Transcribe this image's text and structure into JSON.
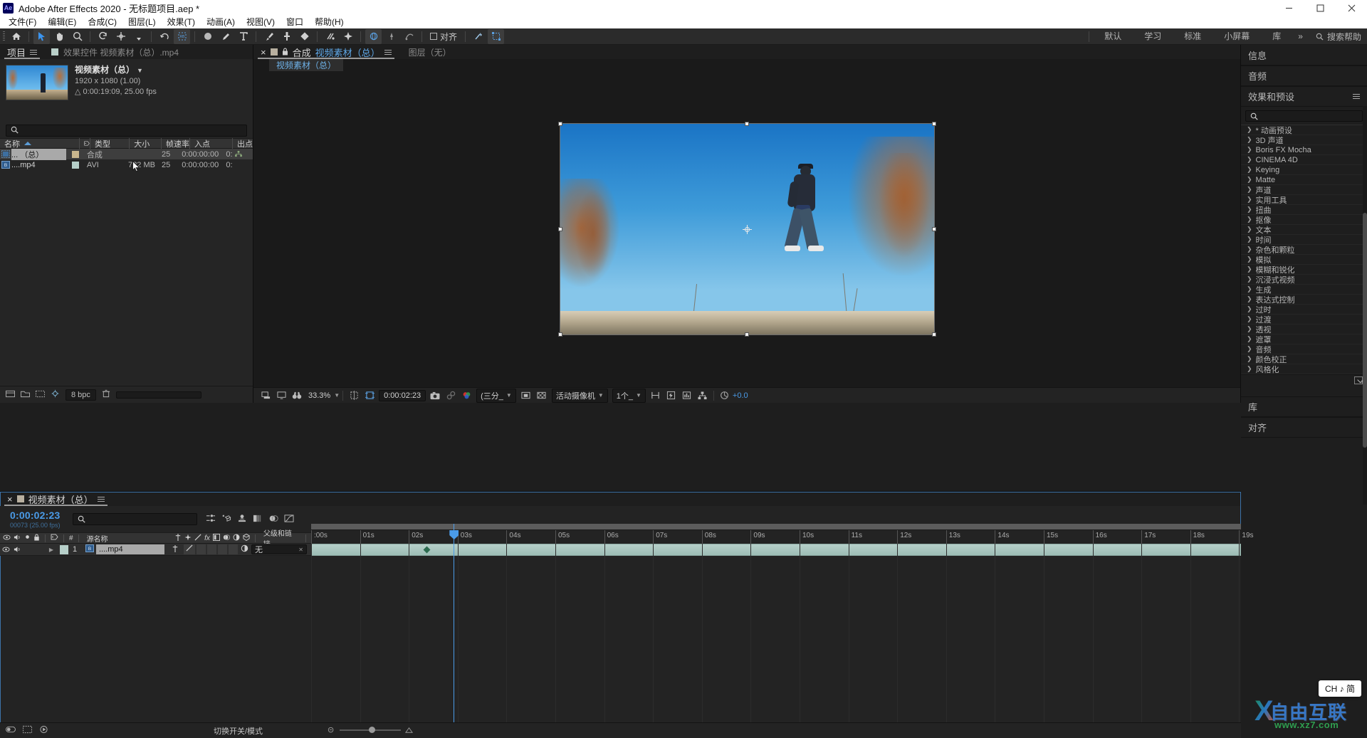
{
  "window": {
    "title": "Adobe After Effects 2020 - 无标题项目.aep *",
    "logo": "Ae",
    "buttons": [
      "minimize-button",
      "maximize-button",
      "close-button"
    ]
  },
  "menubar": {
    "items": [
      "文件(F)",
      "编辑(E)",
      "合成(C)",
      "图层(L)",
      "效果(T)",
      "动画(A)",
      "视图(V)",
      "窗口",
      "帮助(H)"
    ]
  },
  "toolbar": {
    "align_label": "对齐",
    "workspaces": [
      "默认",
      "学习",
      "标准",
      "小屏幕",
      "库"
    ],
    "overflow": "»",
    "search_placeholder": "搜索帮助"
  },
  "project": {
    "tab_project": "项目",
    "tab_effect_controls": "效果控件 视频素材（总）.mp4",
    "item_name": "视频素材（总）",
    "item_resolution": "1920 x 1080 (1.00)",
    "item_duration": "△ 0:00:19:09, 25.00 fps",
    "search_placeholder": "",
    "columns": [
      "名称",
      "类型",
      "大小",
      "帧速率",
      "入点",
      "出点"
    ],
    "rows": [
      {
        "name": "... （总）",
        "type": "合成",
        "size": "",
        "fps": "25",
        "in": "0:00:00:00",
        "out": "0:"
      },
      {
        "name": "....mp4",
        "type": "AVI",
        "size": "7?2 MB",
        "fps": "25",
        "in": "0:00:00:00",
        "out": "0:"
      }
    ],
    "bit_depth": "8 bpc"
  },
  "composition": {
    "tab_label": "合成",
    "tab_name": "视频素材（总）",
    "tab_layer": "图层（无）",
    "breadcrumb": "视频素材（总）",
    "viewer_bar": {
      "zoom": "33.3%",
      "time": "0:00:02:23",
      "resolution": "(三分_",
      "camera": "活动摄像机",
      "views": "1个_",
      "exposure": "+0.0"
    }
  },
  "right_panel": {
    "info": "信息",
    "audio": "音频",
    "effects_title": "效果和预设",
    "search_placeholder": "",
    "library": "库",
    "align": "对齐",
    "effects": [
      "* 动画预设",
      "3D 声道",
      "Boris FX Mocha",
      "CINEMA 4D",
      "Keying",
      "Matte",
      "声道",
      "实用工具",
      "扭曲",
      "抠像",
      "文本",
      "时间",
      "杂色和颗粒",
      "模拟",
      "模糊和锐化",
      "沉浸式视频",
      "生成",
      "表达式控制",
      "过时",
      "过渡",
      "透视",
      "遮罩",
      "音频",
      "颜色校正",
      "风格化"
    ]
  },
  "timeline": {
    "tab_name": "视频素材（总）",
    "current_time": "0:00:02:23",
    "frame_info": "00073 (25.00 fps)",
    "search_placeholder": "",
    "columns": [
      "源名称",
      "父级和链接"
    ],
    "layers": [
      {
        "index": "1",
        "source_name": "....mp4",
        "parent": "无"
      }
    ],
    "ruler_ticks": [
      ":00s",
      "01s",
      "02s",
      "03s",
      "04s",
      "05s",
      "06s",
      "07s",
      "08s",
      "09s",
      "10s",
      "11s",
      "12s",
      "13s",
      "14s",
      "15s",
      "16s",
      "17s",
      "18s",
      "19s"
    ],
    "switches_modes": "切换开关/模式"
  },
  "overlays": {
    "ime": "CH ♪ 简",
    "watermark_cn": "自由互联",
    "watermark_url": "www.xz7.com",
    "watermark_mark": "X"
  },
  "colors": {
    "accent_blue": "#4a9be8",
    "panel_bg": "#1e1e1e",
    "toolbar_bg": "#2b2b2b",
    "selection": "#3e3e3e"
  }
}
